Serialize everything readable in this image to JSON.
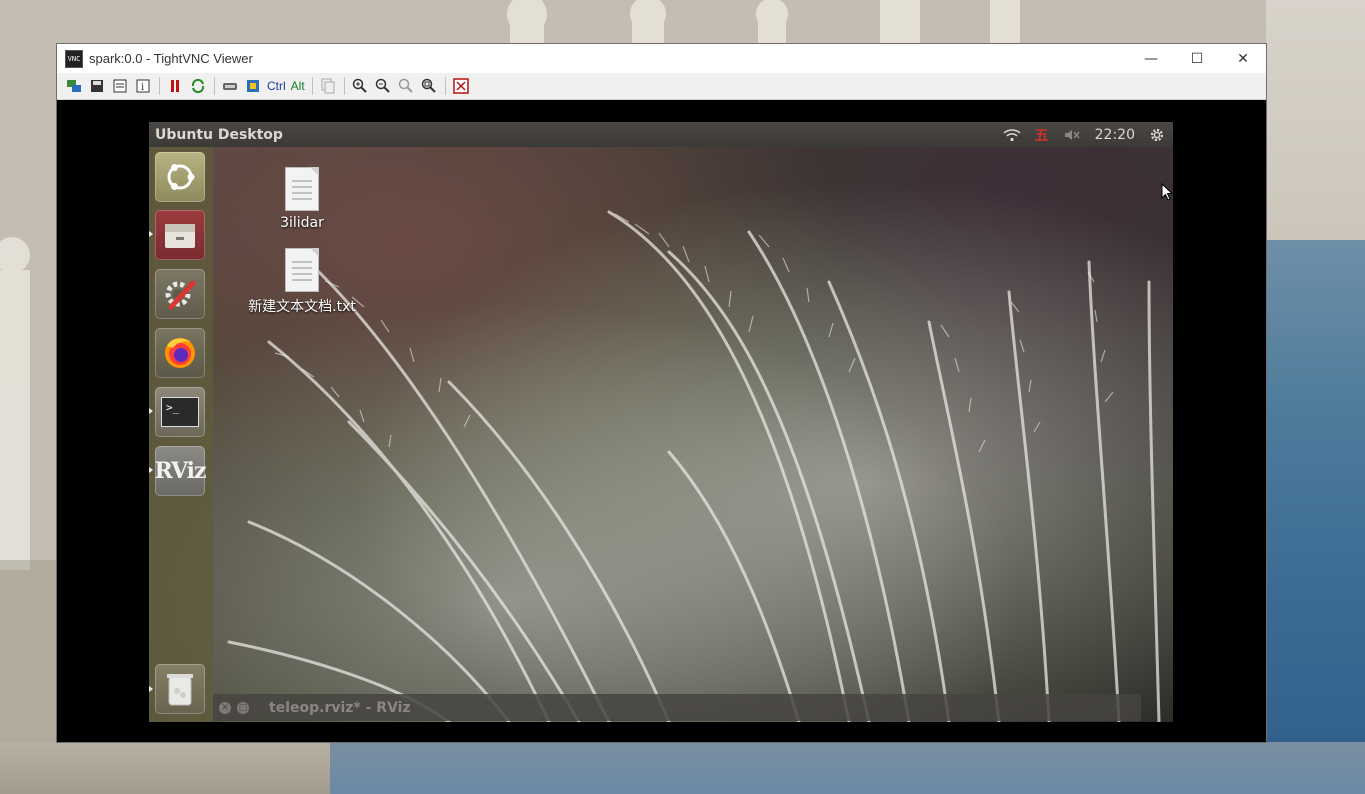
{
  "vnc": {
    "title": "spark:0.0 - TightVNC Viewer",
    "app_icon_text": "VNC",
    "toolbar": {
      "ctrl_label": "Ctrl",
      "alt_label": "Alt"
    }
  },
  "ubuntu": {
    "topbar_title": "Ubuntu Desktop",
    "ime_indicator": "五",
    "clock": "22:20",
    "launcher": [
      {
        "name": "ubuntu-dash-icon"
      },
      {
        "name": "files-icon"
      },
      {
        "name": "system-settings-icon"
      },
      {
        "name": "firefox-icon"
      },
      {
        "name": "terminal-icon",
        "text": ">_"
      },
      {
        "name": "rviz-icon",
        "text": "RViz"
      },
      {
        "name": "trash-icon"
      }
    ],
    "desktop_files": [
      {
        "label": "3ilidar"
      },
      {
        "label": "新建文本文档.txt"
      }
    ],
    "rviz_window_title": "teleop.rviz* - RViz"
  }
}
